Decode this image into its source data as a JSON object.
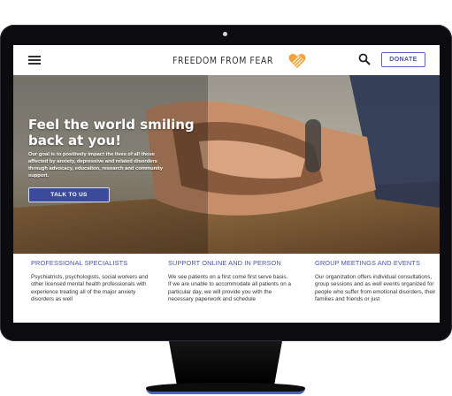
{
  "navbar": {
    "logo_text": "FREEDOM FROM FEAR",
    "donate_label": "DONATE",
    "brand_color": "#f4a13b"
  },
  "hero": {
    "title": "Feel the world smiling back at you!",
    "text": "Our goal is to positively impact the lives of all those affected by anxiety, depressive and related disorders through advocacy, education, research and community support.",
    "button_label": "TALK TO US"
  },
  "columns": [
    {
      "title": "PROFESSIONAL SPECIALISTS",
      "text": "Psychiatrists, psychologists, social workers and other licensed mental health professionals with experience treating all of the major anxiety disorders as well"
    },
    {
      "title": "SUPPORT ONLINE AND IN PERSON",
      "text": "We see patients on a first come first serve basis. If we are unable to accommodate all patients on a particular day, we will provide you with the necessary paperwork and schedule"
    },
    {
      "title": "GROUP MEETINGS AND EVENTS",
      "text": "Our organization offers individual consultations, group sessions and as well events organized for people who suffer from emotional disorders, their families and friends or just"
    }
  ]
}
